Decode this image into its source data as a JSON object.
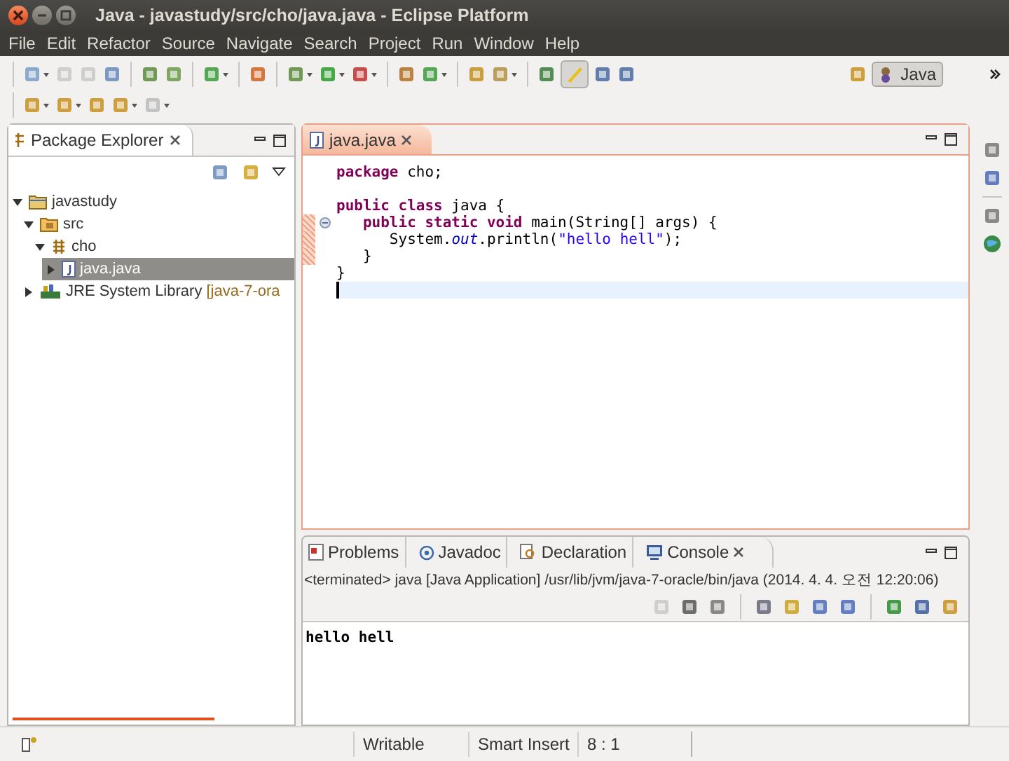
{
  "window": {
    "title": "Java - javastudy/src/cho/java.java - Eclipse Platform"
  },
  "menu": [
    "File",
    "Edit",
    "Refactor",
    "Source",
    "Navigate",
    "Search",
    "Project",
    "Run",
    "Window",
    "Help"
  ],
  "toolbar": {
    "mark_occurrences_on": true,
    "perspective": {
      "label": "Java",
      "selected": true
    }
  },
  "package_explorer": {
    "title": "Package Explorer",
    "tree": [
      {
        "kind": "project",
        "label": "javastudy",
        "expanded": true,
        "selected": false,
        "children": [
          {
            "kind": "source-folder",
            "label": "src",
            "expanded": true,
            "selected": false,
            "children": [
              {
                "kind": "package",
                "label": "cho",
                "expanded": true,
                "selected": false,
                "children": [
                  {
                    "kind": "java-file",
                    "label": "java.java",
                    "expanded": false,
                    "selected": true
                  }
                ]
              }
            ]
          },
          {
            "kind": "library",
            "label": "JRE System Library",
            "suffix": "[java-7-ora",
            "expanded": false,
            "selected": false
          }
        ]
      }
    ]
  },
  "editor": {
    "tab": {
      "label": "java.java",
      "selected": true
    },
    "lines": [
      {
        "changed": false,
        "fold": false,
        "current": false,
        "tokens": [
          {
            "kind": "keyword",
            "text": "package"
          },
          {
            "kind": "plain",
            "text": " cho;"
          }
        ]
      },
      {
        "changed": false,
        "fold": false,
        "current": false
      },
      {
        "changed": false,
        "fold": false,
        "current": false,
        "tokens": [
          {
            "kind": "keyword",
            "text": "public class"
          },
          {
            "kind": "plain",
            "text": " java {"
          }
        ]
      },
      {
        "changed": true,
        "fold": true,
        "current": false,
        "tokens": [
          {
            "kind": "keyword",
            "text": "   public static void"
          },
          {
            "kind": "plain",
            "text": " main(String[] args) {"
          }
        ]
      },
      {
        "changed": true,
        "fold": false,
        "current": false,
        "tokens": [
          {
            "kind": "plain",
            "text": "      System."
          },
          {
            "kind": "static-field",
            "text": "out"
          },
          {
            "kind": "plain",
            "text": ".println("
          },
          {
            "kind": "string",
            "text": "\"hello hell\""
          },
          {
            "kind": "plain",
            "text": ");"
          }
        ]
      },
      {
        "changed": true,
        "fold": false,
        "current": false,
        "tokens": [
          {
            "kind": "plain",
            "text": "   }"
          }
        ]
      },
      {
        "changed": false,
        "fold": false,
        "current": false,
        "tokens": [
          {
            "kind": "plain",
            "text": "}"
          }
        ]
      },
      {
        "changed": false,
        "fold": false,
        "current": true
      }
    ]
  },
  "bottom_panel": {
    "tabs": [
      {
        "label": "Problems",
        "selected": false
      },
      {
        "label": "Javadoc",
        "selected": false
      },
      {
        "label": "Declaration",
        "selected": false
      },
      {
        "label": "Console",
        "selected": true
      }
    ],
    "console_header": "<terminated> java [Java Application] /usr/lib/jvm/java-7-oracle/bin/java (2014. 4. 4. 오전 12:20:06)",
    "output": "hello hell"
  },
  "status_bar": {
    "writable": "Writable",
    "insert_mode": "Smart Insert",
    "position": "8 : 1"
  }
}
